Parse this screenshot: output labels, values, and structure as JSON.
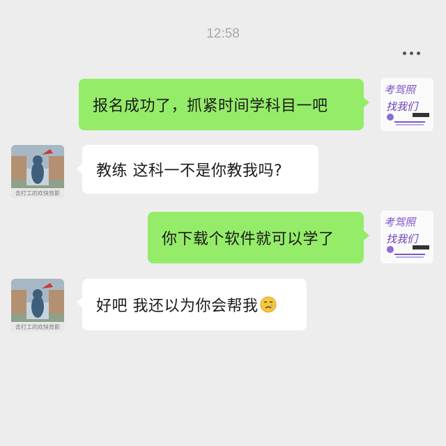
{
  "chat": {
    "timestamp": "12:58",
    "more_icon": "more-dots-icon",
    "messages": [
      {
        "side": "out",
        "text": "报名成功了，抓紧时间学科目一吧",
        "avatar": "book-cover-avatar"
      },
      {
        "side": "in",
        "text": "教练 这科一不是你教我吗?",
        "avatar": "tom-cat-avatar"
      },
      {
        "side": "out",
        "text": "你下载个软件就可以学了",
        "avatar": "book-cover-avatar"
      },
      {
        "side": "in",
        "text": "好吧 我还以为你会帮我",
        "avatar": "tom-cat-avatar",
        "emoji": "crying-face-icon"
      }
    ]
  },
  "avatars": {
    "tom_cat_caption": "去打工的欢快背影",
    "book_cover_text": "考驾照找我们",
    "book_cover_tag": "教练们"
  },
  "colors": {
    "background": "#ededed",
    "outgoing_bubble": "#95ec69",
    "incoming_bubble": "#ffffff"
  }
}
